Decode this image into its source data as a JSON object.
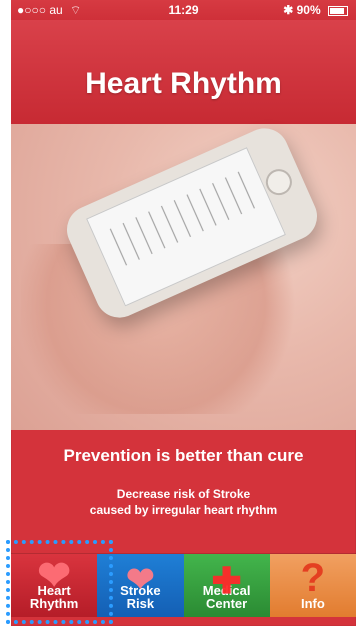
{
  "status_bar": {
    "carrier": "●○○○ au",
    "wifi": "wifi",
    "time": "11:29",
    "battery_text": "90%"
  },
  "header": {
    "title": "Heart Rhythm"
  },
  "main": {
    "prevention": "Prevention is better than cure",
    "description_line1": "Decrease risk of Stroke",
    "description_line2": "caused by irregular heart rhythm"
  },
  "tabs": [
    {
      "label_line1": "Heart",
      "label_line2": "Rhythm",
      "icon": "heart-icon"
    },
    {
      "label_line1": "Stroke",
      "label_line2": "Risk",
      "icon": "heart-icon"
    },
    {
      "label_line1": "Medical",
      "label_line2": "Center",
      "icon": "cross-icon"
    },
    {
      "label_line1": "Info",
      "label_line2": "",
      "icon": "question-icon"
    }
  ],
  "colors": {
    "primary_red": "#d4333b",
    "tab_blue": "#1f7fd6",
    "tab_green": "#43b54c",
    "tab_orange": "#f1a061",
    "selection_blue": "#2b9cff"
  }
}
